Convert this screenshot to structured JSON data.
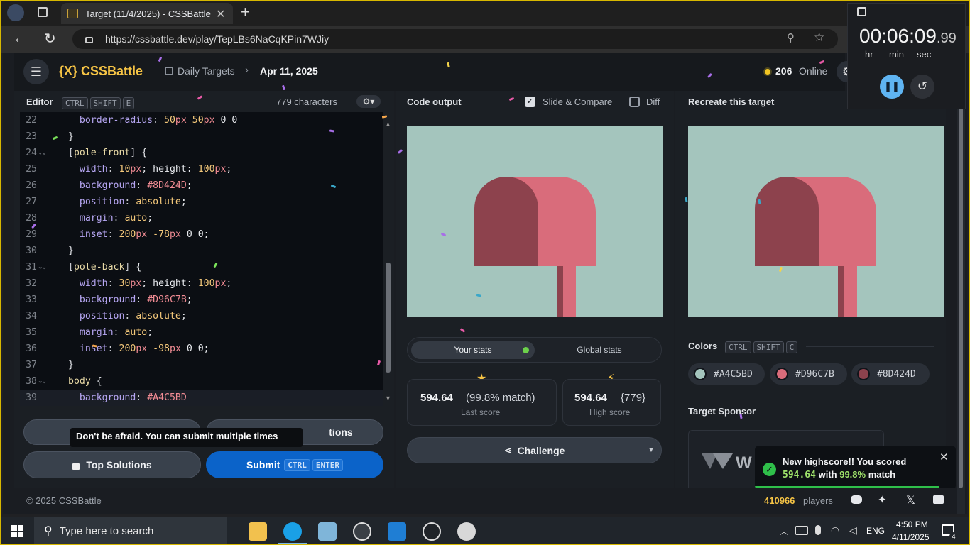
{
  "browser": {
    "tab_title": "Target (11/4/2025) - CSSBattle",
    "url": "https://cssbattle.dev/play/TepLBs6NaCqKPin7WJiy"
  },
  "header": {
    "logo": "{X} CSSBattle",
    "breadcrumb_parent": "Daily Targets",
    "breadcrumb_current": "Apr 11, 2025",
    "online_count": "206",
    "online_label": "Online"
  },
  "timer": {
    "display": "00:06:09",
    "fraction": ".99",
    "unit_hr": "hr",
    "unit_min": "min",
    "unit_sec": "sec"
  },
  "editor": {
    "title": "Editor",
    "shortcut": [
      "CTRL",
      "SHIFT",
      "E"
    ],
    "char_count": "779 characters",
    "lines": [
      {
        "n": "22",
        "t": "  border-radius: 50px 50px 0 0"
      },
      {
        "n": "23",
        "t": "}"
      },
      {
        "n": "24",
        "t": "[pole-front] {"
      },
      {
        "n": "25",
        "t": "  width: 10px; height: 100px;"
      },
      {
        "n": "26",
        "t": "  background: #8D424D;"
      },
      {
        "n": "27",
        "t": "  position: absolute;"
      },
      {
        "n": "28",
        "t": "  margin: auto;"
      },
      {
        "n": "29",
        "t": "  inset: 200px -78px 0 0;"
      },
      {
        "n": "30",
        "t": "}"
      },
      {
        "n": "31",
        "t": "[pole-back] {"
      },
      {
        "n": "32",
        "t": "  width: 30px; height: 100px;"
      },
      {
        "n": "33",
        "t": "  background: #D96C7B;"
      },
      {
        "n": "34",
        "t": "  position: absolute;"
      },
      {
        "n": "35",
        "t": "  margin: auto;"
      },
      {
        "n": "36",
        "t": "  inset: 200px -98px 0 0;"
      },
      {
        "n": "37",
        "t": "}"
      },
      {
        "n": "38",
        "t": "body {"
      },
      {
        "n": "39",
        "t": "  background: #A4C5BD"
      }
    ]
  },
  "actions": {
    "tooltip": "Don't be afraid. You can submit multiple times",
    "partial_button": "tions",
    "top_solutions": "Top Solutions",
    "submit": "Submit",
    "submit_keys": [
      "CTRL",
      "ENTER"
    ]
  },
  "output": {
    "title": "Code output",
    "slide_compare": "Slide & Compare",
    "diff": "Diff",
    "tabs": [
      "Your stats",
      "Global stats"
    ],
    "last_score": "594.64",
    "last_match": "(99.8% match)",
    "last_label": "Last score",
    "high_score": "594.64",
    "high_chars": "{779}",
    "high_label": "High score",
    "challenge": "Challenge"
  },
  "target": {
    "title": "Recreate this target",
    "colors_title": "Colors",
    "colors_keys": [
      "CTRL",
      "SHIFT",
      "C"
    ],
    "colors": [
      "#A4C5BD",
      "#D96C7B",
      "#8D424D"
    ],
    "sponsor_title": "Target Sponsor"
  },
  "toast": {
    "line1": "New highscore!! You scored",
    "score": "594.64",
    "with": "with",
    "match": "99.8%",
    "match_word": "match"
  },
  "footer": {
    "copyright": "© 2025 CSSBattle",
    "players_count": "410966",
    "players_label": "players"
  },
  "taskbar": {
    "search": "Type here to search",
    "lang": "ENG",
    "time": "4:50 PM",
    "date": "4/11/2025",
    "notif": "4"
  },
  "art_colors": {
    "bg": "#A4C5BD",
    "light": "#D96C7B",
    "dark": "#8D424D"
  }
}
